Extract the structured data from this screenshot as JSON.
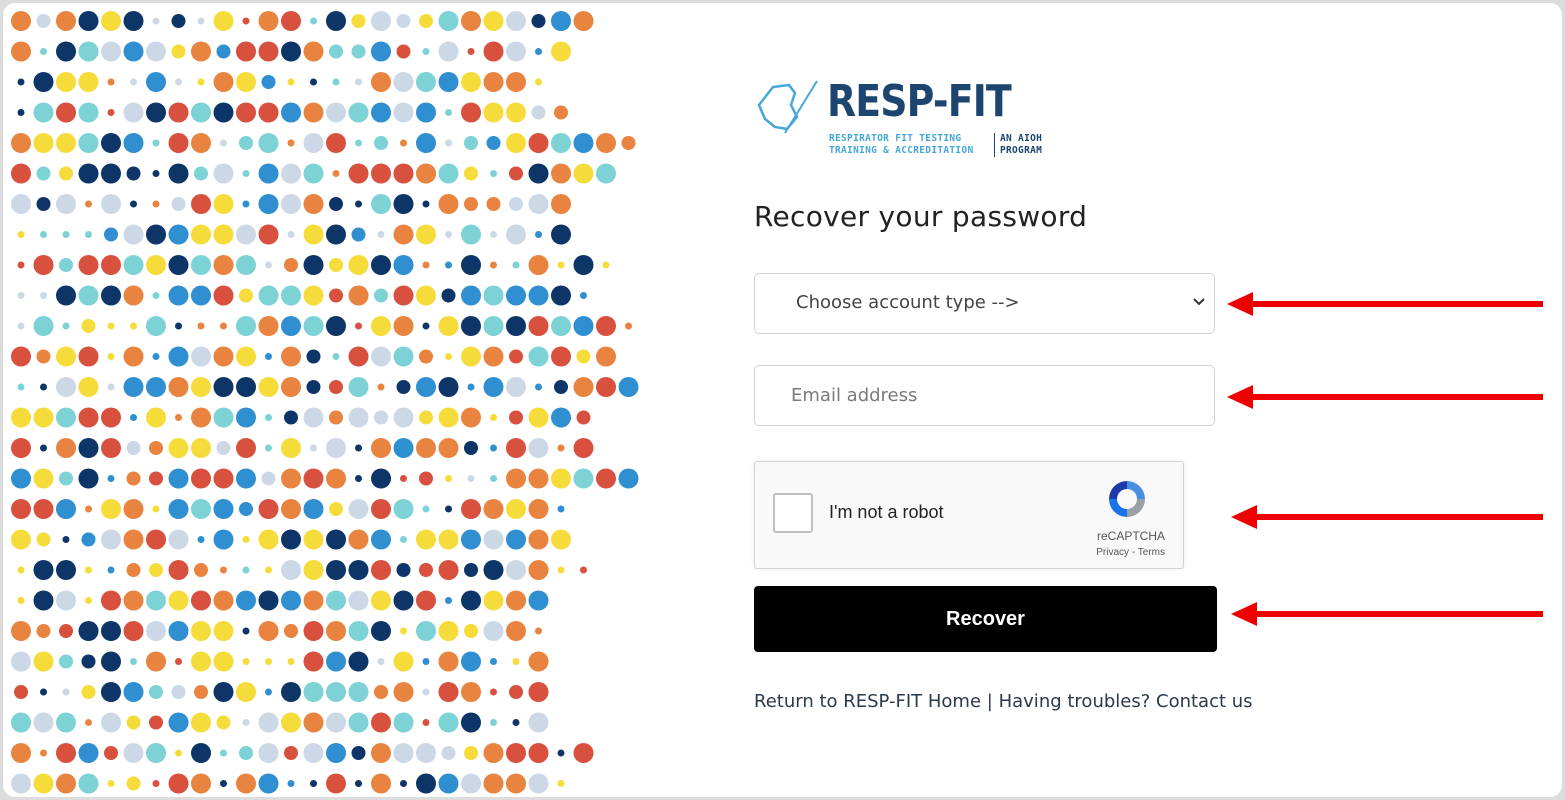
{
  "logo": {
    "wordmark": "RESP-FIT",
    "line1_left": "RESPIRATOR FIT TESTING",
    "line2_left": "TRAINING & ACCREDITATION",
    "line1_right": "AN AIOH",
    "line2_right": "PROGRAM"
  },
  "page_title": "Recover your password",
  "account_select": {
    "selected": "Choose account type -->"
  },
  "email": {
    "placeholder": "Email address"
  },
  "captcha": {
    "label": "I'm not a robot",
    "brand": "reCAPTCHA",
    "privacy": "Privacy",
    "separator": "-",
    "terms": "Terms"
  },
  "recover_button": "Recover",
  "footer": {
    "home_link": "Return to RESP-FIT Home",
    "separator": "|",
    "contact_link": "Having troubles? Contact us"
  },
  "colors": {
    "accent_arrow": "#ee0000",
    "logo_dark": "#1c4670",
    "logo_light": "#45a7d8",
    "dot_palette": [
      "#e8843f",
      "#f6dc3b",
      "#7dd2d6",
      "#ccd8e6",
      "#0e3567",
      "#2f8fd0",
      "#d8503e"
    ]
  }
}
